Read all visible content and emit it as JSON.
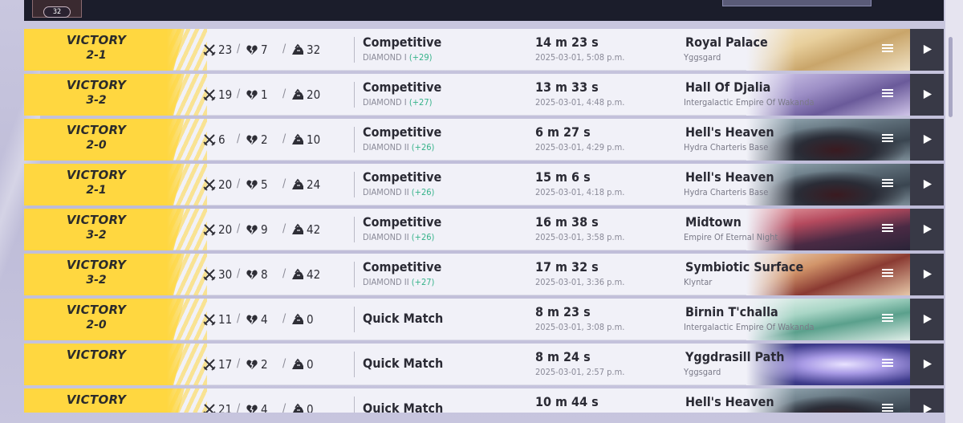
{
  "header": {
    "player_level": "32",
    "mode_filter_label": ""
  },
  "colors": {
    "victory": "#ffd740",
    "rank_delta": "#36b38a",
    "row_bg": "#f1f1f8",
    "play_button": "#383946"
  },
  "icons": {
    "kills": "crossed-swords-icon",
    "deaths": "broken-heart-icon",
    "assists": "helping-hand-icon",
    "details": "menu-lines-icon",
    "replay": "play-icon"
  },
  "matches": [
    {
      "result": "VICTORY",
      "score": "2-1",
      "kills": "23",
      "deaths": "7",
      "assists": "32",
      "mode": "Competitive",
      "rank": "DIAMOND I",
      "rank_delta": "(+29)",
      "duration": "14 m 23 s",
      "datetime": "2025-03-01, 5:08 p.m.",
      "map": "Royal Palace",
      "region": "Yggsgard",
      "art": "palace"
    },
    {
      "result": "VICTORY",
      "score": "3-2",
      "kills": "19",
      "deaths": "1",
      "assists": "20",
      "mode": "Competitive",
      "rank": "DIAMOND I",
      "rank_delta": "(+27)",
      "duration": "13 m 33 s",
      "datetime": "2025-03-01, 4:48 p.m.",
      "map": "Hall Of Djalia",
      "region": "Intergalactic Empire Of Wakanda",
      "art": "djalia"
    },
    {
      "result": "VICTORY",
      "score": "2-0",
      "kills": "6",
      "deaths": "2",
      "assists": "10",
      "mode": "Competitive",
      "rank": "DIAMOND II",
      "rank_delta": "(+26)",
      "duration": "6 m 27 s",
      "datetime": "2025-03-01, 4:29 p.m.",
      "map": "Hell's Heaven",
      "region": "Hydra Charteris Base",
      "art": "hydra"
    },
    {
      "result": "VICTORY",
      "score": "2-1",
      "kills": "20",
      "deaths": "5",
      "assists": "24",
      "mode": "Competitive",
      "rank": "DIAMOND II",
      "rank_delta": "(+26)",
      "duration": "15 m 6 s",
      "datetime": "2025-03-01, 4:18 p.m.",
      "map": "Hell's Heaven",
      "region": "Hydra Charteris Base",
      "art": "hydra"
    },
    {
      "result": "VICTORY",
      "score": "3-2",
      "kills": "20",
      "deaths": "9",
      "assists": "42",
      "mode": "Competitive",
      "rank": "DIAMOND II",
      "rank_delta": "(+26)",
      "duration": "16 m 38 s",
      "datetime": "2025-03-01, 3:58 p.m.",
      "map": "Midtown",
      "region": "Empire Of Eternal Night",
      "art": "midtown"
    },
    {
      "result": "VICTORY",
      "score": "3-2",
      "kills": "30",
      "deaths": "8",
      "assists": "42",
      "mode": "Competitive",
      "rank": "DIAMOND II",
      "rank_delta": "(+27)",
      "duration": "17 m 32 s",
      "datetime": "2025-03-01, 3:36 p.m.",
      "map": "Symbiotic Surface",
      "region": "Klyntar",
      "art": "klyntar"
    },
    {
      "result": "VICTORY",
      "score": "2-0",
      "kills": "11",
      "deaths": "4",
      "assists": "0",
      "mode": "Quick Match",
      "rank": "",
      "rank_delta": "",
      "duration": "8 m 23 s",
      "datetime": "2025-03-01, 3:08 p.m.",
      "map": "Birnin T'challa",
      "region": "Intergalactic Empire Of Wakanda",
      "art": "birnin"
    },
    {
      "result": "VICTORY",
      "score": "",
      "kills": "17",
      "deaths": "2",
      "assists": "0",
      "mode": "Quick Match",
      "rank": "",
      "rank_delta": "",
      "duration": "8 m 24 s",
      "datetime": "2025-03-01, 2:57 p.m.",
      "map": "Yggdrasill Path",
      "region": "Yggsgard",
      "art": "yggdrasill"
    },
    {
      "result": "VICTORY",
      "score": "",
      "kills": "21",
      "deaths": "4",
      "assists": "0",
      "mode": "Quick Match",
      "rank": "",
      "rank_delta": "",
      "duration": "10 m 44 s",
      "datetime": "",
      "map": "Hell's Heaven",
      "region": "",
      "art": "hydra"
    }
  ]
}
